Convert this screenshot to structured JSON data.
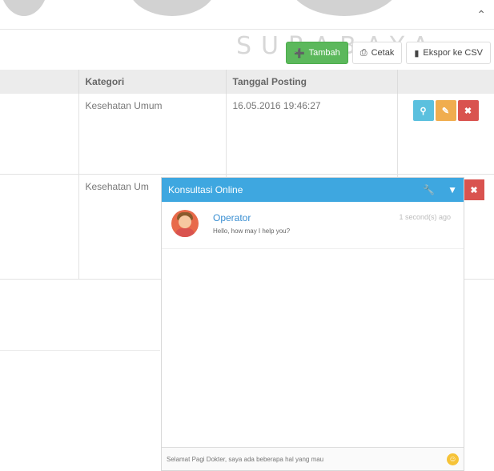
{
  "watermark": "SURABAYA",
  "toolbar": {
    "add_label": "Tambah",
    "print_label": "Cetak",
    "export_label": "Ekspor ke CSV"
  },
  "table": {
    "headers": [
      "",
      "Kategori",
      "Tanggal Posting",
      ""
    ],
    "rows": [
      {
        "kategori": "Kesehatan Umum",
        "tanggal": "16.05.2016 19:46:27"
      },
      {
        "kategori": "Kesehatan Um",
        "tanggal": ""
      }
    ]
  },
  "chat": {
    "title": "Konsultasi Online",
    "messages": [
      {
        "name": "Operator",
        "time": "1 second(s) ago",
        "text": "Hello, how may I help you?"
      }
    ],
    "input_value": "Selamat Pagi Dokter, saya ada beberapa hal yang mau"
  },
  "icons": {
    "collapse": "chevron-up-icon",
    "add": "plus-circle-icon",
    "print": "printer-icon",
    "export": "file-icon",
    "view": "search-icon",
    "edit": "pencil-icon",
    "delete": "close-icon",
    "settings": "wrench-icon",
    "minimize": "chevron-down-icon",
    "emoji": "smiley-icon"
  },
  "colors": {
    "primary": "#3ea7e0",
    "success": "#5cb85c",
    "info": "#5bc0de",
    "warning": "#f0ad4e",
    "danger": "#d9534f"
  }
}
